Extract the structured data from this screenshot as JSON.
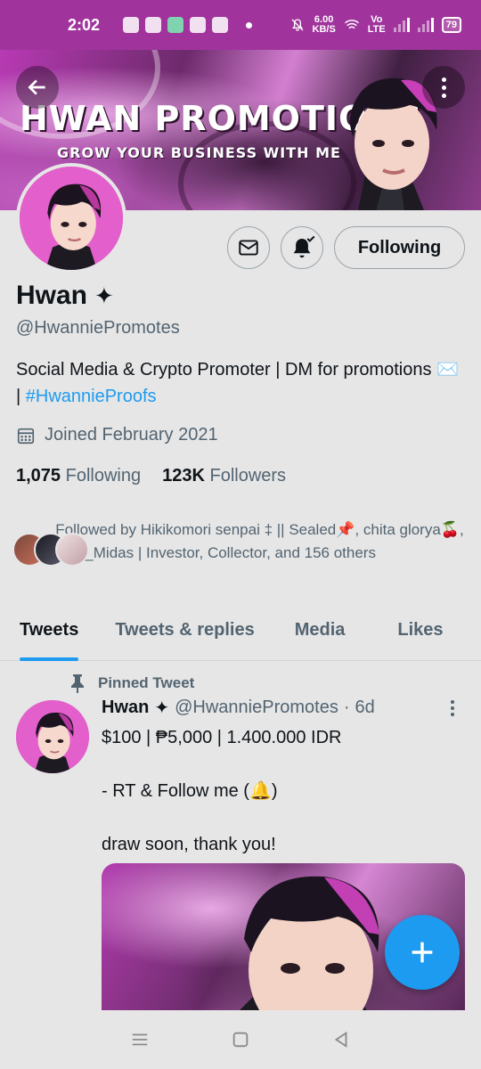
{
  "status_bar": {
    "time": "2:02",
    "net_speed_value": "6.00",
    "net_speed_unit": "KB/S",
    "volte": "Vo",
    "lte": "LTE",
    "battery": "79"
  },
  "banner": {
    "title": "HWAN PROMOTIONS",
    "tagline": "GROW YOUR BUSINESS WITH ME"
  },
  "actions": {
    "follow_label": "Following"
  },
  "profile": {
    "name": "Hwan",
    "verified_glyph": "✦",
    "handle": "@HwanniePromotes",
    "bio_text": "Social Media & Crypto Promoter | DM for promotions ✉️ | ",
    "bio_link": "#HwannieProofs",
    "joined": "Joined February 2021",
    "following_count": "1,075",
    "following_label": "Following",
    "followers_count": "123K",
    "followers_label": "Followers",
    "followed_by": "Followed by Hikikomori senpai ‡ || Sealed📌, chita glorya🍒, NFT_Midas | Investor, Collector, and 156 others"
  },
  "tabs": [
    {
      "label": "Tweets",
      "active": true
    },
    {
      "label": "Tweets & replies",
      "active": false
    },
    {
      "label": "Media",
      "active": false
    },
    {
      "label": "Likes",
      "active": false
    }
  ],
  "tweet": {
    "pinned_label": "Pinned Tweet",
    "author": "Hwan",
    "verified_glyph": "✦",
    "handle": "@HwanniePromotes",
    "separator": "·",
    "age": "6d",
    "text": "$100 | ₱5,000 | 1.400.000 IDR\n\n- RT & Follow me (🔔)\n\ndraw soon, thank you!"
  },
  "colors": {
    "accent": "#1d9bf0",
    "status_bar": "#a0349c",
    "background": "#e6e6e6"
  }
}
